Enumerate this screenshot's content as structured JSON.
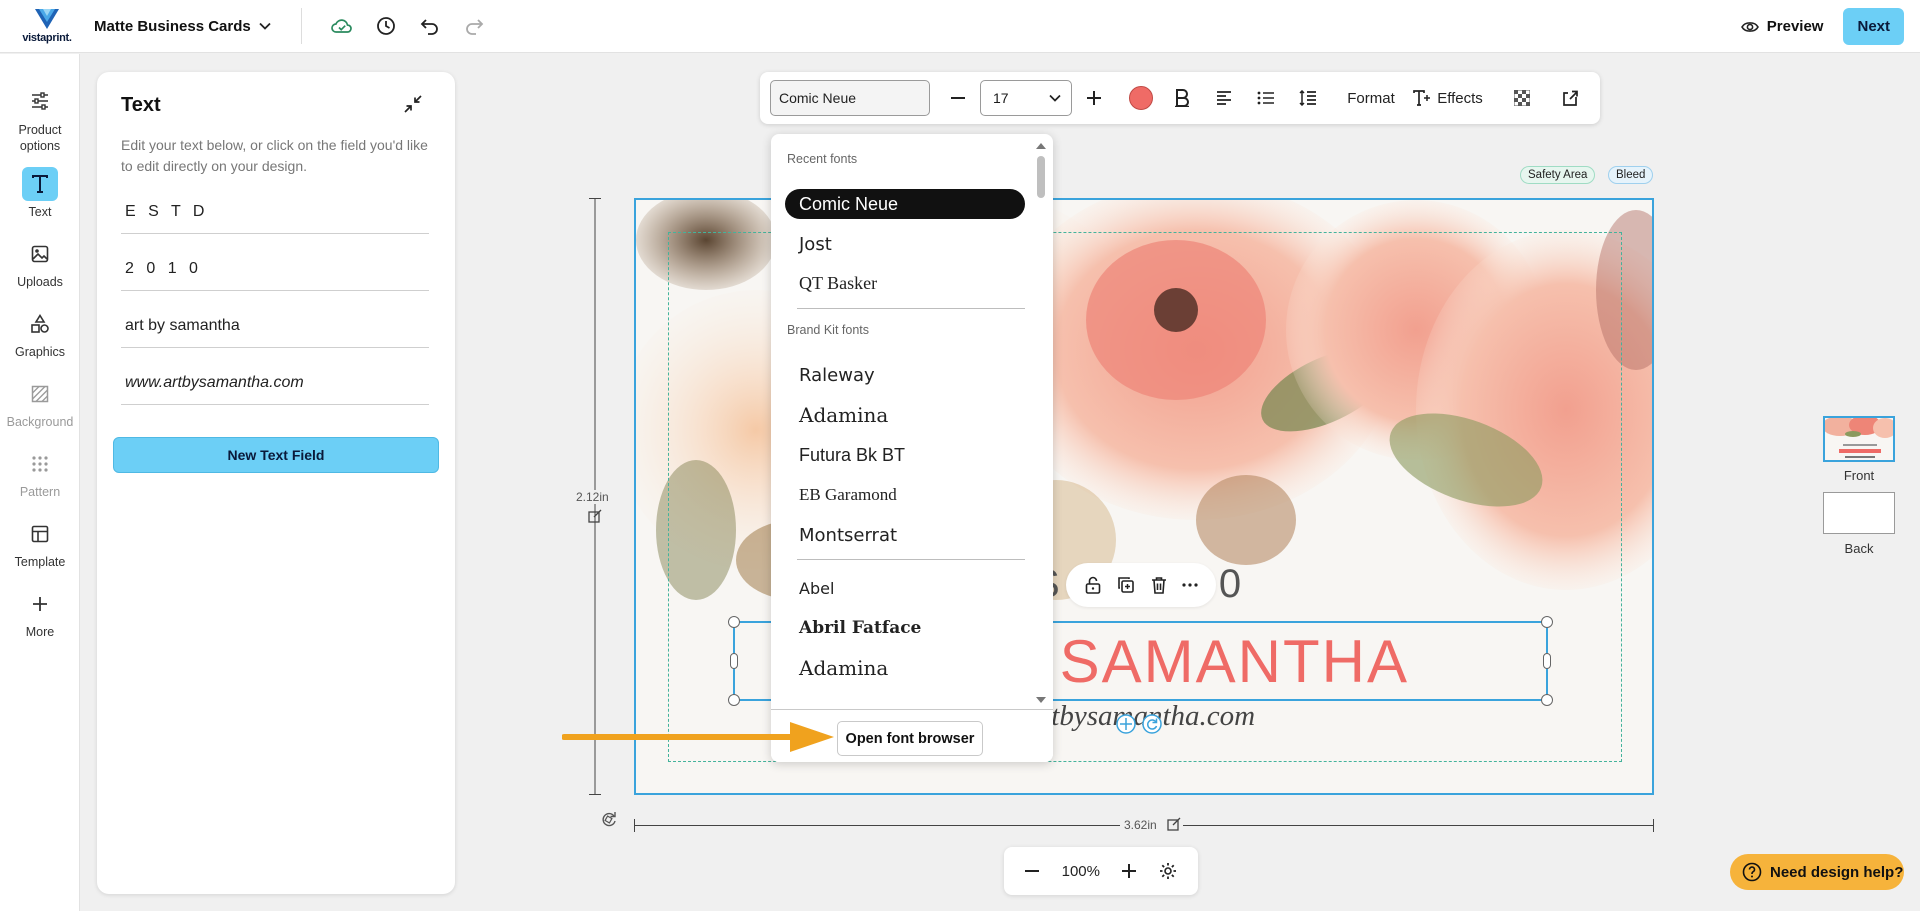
{
  "app": {
    "logo_text": "vistaprint.",
    "product_name": "Matte Business Cards",
    "preview_label": "Preview",
    "next_label": "Next"
  },
  "rail": {
    "items": [
      {
        "label": "Product options",
        "icon": "sliders-icon"
      },
      {
        "label": "Text",
        "icon": "text-icon"
      },
      {
        "label": "Uploads",
        "icon": "image-icon"
      },
      {
        "label": "Graphics",
        "icon": "shapes-icon"
      },
      {
        "label": "Background",
        "icon": "background-icon"
      },
      {
        "label": "Pattern",
        "icon": "pattern-icon"
      },
      {
        "label": "Template",
        "icon": "template-icon"
      },
      {
        "label": "More",
        "icon": "plus-icon"
      }
    ]
  },
  "panel": {
    "title": "Text",
    "help": "Edit your text below, or click on the field you'd like to edit directly on your design.",
    "fields": [
      "E S T D",
      "2 0 1 0",
      "art by samantha",
      "www.artbysamantha.com"
    ],
    "new_field_label": "New Text Field"
  },
  "toolbar": {
    "font_value": "Comic Neue",
    "size_value": "17",
    "format_label": "Format",
    "effects_label": "Effects",
    "text_color": "#ef6b66"
  },
  "font_dropdown": {
    "recent_heading": "Recent fonts",
    "recent": [
      "Comic Neue",
      "Jost",
      "QT Basker"
    ],
    "brand_heading": "Brand Kit fonts",
    "brand": [
      "Raleway",
      "Adamina",
      "Futura Bk BT",
      "EB Garamond",
      "Montserrat"
    ],
    "all": [
      "Abel",
      "Abril Fatface",
      "Adamina"
    ],
    "open_browser_label": "Open font browser"
  },
  "canvas": {
    "safety_label": "Safety Area",
    "bleed_label": "Bleed",
    "height_label": "2.12in",
    "width_label": "3.62in",
    "estd_text": "S 2 0 1 0",
    "name_text": "Y SAMANTHA",
    "url_text": "rtbysamantha.com"
  },
  "pages": {
    "front_label": "Front",
    "back_label": "Back"
  },
  "zoom": {
    "level": "100%"
  },
  "help": {
    "label": "Need design help?"
  },
  "colors": {
    "accent": "#6ccff6",
    "selection": "#3aa3dc",
    "help_button": "#f6b33b",
    "arrow": "#f0a21e"
  }
}
